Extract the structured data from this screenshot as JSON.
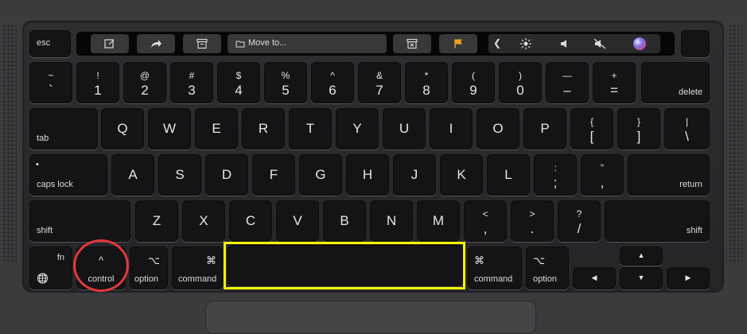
{
  "touch_bar": {
    "esc": "esc",
    "move_to": "Move to...",
    "back_chevron": "❮"
  },
  "number_row": [
    {
      "top": "~",
      "bot": "`"
    },
    {
      "top": "!",
      "bot": "1"
    },
    {
      "top": "@",
      "bot": "2"
    },
    {
      "top": "#",
      "bot": "3"
    },
    {
      "top": "$",
      "bot": "4"
    },
    {
      "top": "%",
      "bot": "5"
    },
    {
      "top": "^",
      "bot": "6"
    },
    {
      "top": "&",
      "bot": "7"
    },
    {
      "top": "*",
      "bot": "8"
    },
    {
      "top": "(",
      "bot": "9"
    },
    {
      "top": ")",
      "bot": "0"
    },
    {
      "top": "—",
      "bot": "–"
    },
    {
      "top": "+",
      "bot": "="
    }
  ],
  "delete": "delete",
  "tab": "tab",
  "qwerty_row": [
    "Q",
    "W",
    "E",
    "R",
    "T",
    "Y",
    "U",
    "I",
    "O",
    "P"
  ],
  "bracket_keys": [
    {
      "top": "{",
      "bot": "["
    },
    {
      "top": "}",
      "bot": "]"
    },
    {
      "top": "|",
      "bot": "\\"
    }
  ],
  "caps_lock": "caps lock",
  "caps_dot": "•",
  "home_row": [
    "A",
    "S",
    "D",
    "F",
    "G",
    "H",
    "J",
    "K",
    "L"
  ],
  "semicolon_keys": [
    {
      "top": ":",
      "bot": ";"
    },
    {
      "top": "\"",
      "bot": ","
    }
  ],
  "return": "return",
  "shift_left": "shift",
  "bottom_letters": [
    "Z",
    "X",
    "C",
    "V",
    "B",
    "N",
    "M"
  ],
  "punct_keys": [
    {
      "top": "<",
      "bot": ","
    },
    {
      "top": ">",
      "bot": "."
    },
    {
      "top": "?",
      "bot": "/"
    }
  ],
  "shift_right": "shift",
  "modifiers": {
    "fn": "fn",
    "globe": "🌐",
    "control": "control",
    "control_symbol": "^",
    "option_left": "option",
    "option_symbol": "⌥",
    "command_left": "command",
    "command_symbol": "⌘",
    "command_right": "command",
    "option_right": "option"
  },
  "arrows": {
    "left": "◀",
    "up": "▲",
    "down": "▼",
    "right": "▶"
  },
  "colors": {
    "highlight_space": "#f6f500",
    "highlight_control": "#e4383a"
  }
}
